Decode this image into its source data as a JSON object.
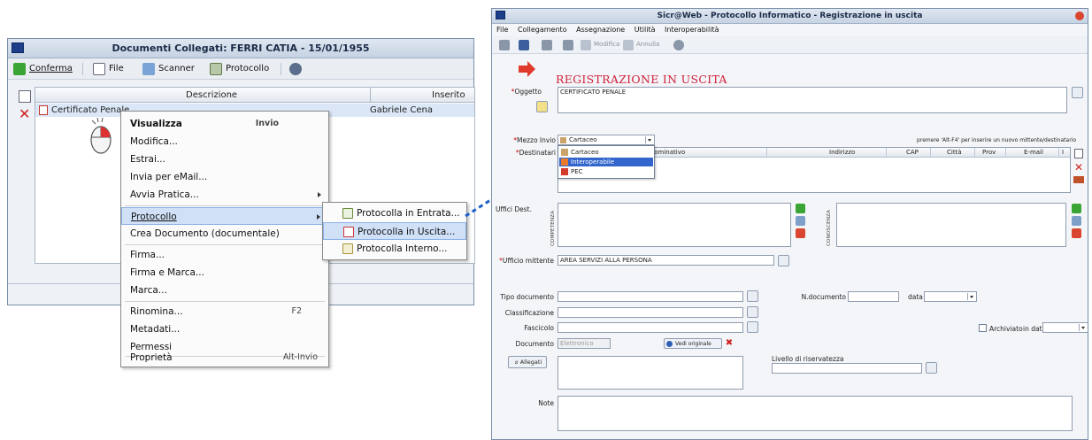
{
  "left_window": {
    "title": "Documenti Collegati: FERRI CATIA - 15/01/1955",
    "toolbar": {
      "conferma": "Conferma",
      "file": "File",
      "scanner": "Scanner",
      "protocollo": "Protocollo"
    },
    "grid": {
      "col_descrizione": "Descrizione",
      "col_inserito_da": "Inserito da",
      "rows": [
        {
          "descrizione": "Certificato Penale",
          "inserito_da": "Gabriele Cena"
        }
      ]
    }
  },
  "context_menu": {
    "items": [
      {
        "label": "Visualizza",
        "shortcut": "Invio"
      },
      {
        "label": "Modifica..."
      },
      {
        "label": "Estrai..."
      },
      {
        "label": "Invia per eMail..."
      },
      {
        "label": "Avvia Pratica..."
      },
      {
        "label": "Protocollo"
      },
      {
        "label": "Crea Documento (documentale)"
      },
      {
        "label": "Firma..."
      },
      {
        "label": "Firma e Marca..."
      },
      {
        "label": "Marca..."
      },
      {
        "label": "Rinomina...",
        "shortcut": "F2"
      },
      {
        "label": "Metadati..."
      },
      {
        "label": "Permessi"
      },
      {
        "label": "Proprietà",
        "shortcut": "Alt-Invio"
      }
    ]
  },
  "submenu": {
    "items": [
      {
        "label": "Protocolla in Entrata..."
      },
      {
        "label": "Protocolla in Uscita..."
      },
      {
        "label": "Protocolla Interno..."
      }
    ]
  },
  "right_window": {
    "title": "Sicr@Web - Protocollo Informatico - Registrazione in uscita",
    "menubar": [
      "File",
      "Collegamento",
      "Assegnazione",
      "Utilità",
      "Interoperabilità"
    ],
    "toolbar": {
      "modifica": "Modifica",
      "annulla": "Annulla"
    },
    "heading": "REGISTRAZIONE IN USCITA",
    "fields": {
      "oggetto_label": "Oggetto",
      "oggetto_value": "CERTIFICATO PENALE",
      "mezzo_invio_label": "Mezzo Invio",
      "mezzo_invio_value": "Cartaceo",
      "hint": "premere 'Alt-F4' per inserire un nuovo mittente/destinatario",
      "destinatari_label": "Destinatari",
      "uffici_dest_label": "Uffici Dest.",
      "competenza": "COMPETENZA",
      "conoscenza": "CONOSCENZA",
      "ufficio_mittente_label": "Ufficio mittente",
      "ufficio_mittente_value": "AREA SERVIZI ALLA PERSONA",
      "tipo_documento_label": "Tipo documento",
      "n_documento_label": "N.documento",
      "data_label": "data",
      "classificazione_label": "Classificazione",
      "fascicolo_label": "Fascicolo",
      "archiviato_label": "Archiviato",
      "in_data_label": "in data",
      "documento_label": "Documento",
      "documento_value": "Elettronico",
      "vedi_originale": "Vedi originale",
      "livello_riservatezza_label": "Livello di riservatezza",
      "allegati": "Allegati",
      "note_label": "Note"
    },
    "grid_headers": [
      "Nominativo",
      "Indirizzo",
      "CAP",
      "Città",
      "Prov",
      "E-mail",
      "I"
    ],
    "mezzo_dropdown": [
      "Cartaceo",
      "Interoperabile",
      "PEC"
    ]
  },
  "colors": {
    "heading_red": "#d0203a",
    "arrow_blue": "#1f5fc8",
    "highlight": "#cfe0f7"
  }
}
